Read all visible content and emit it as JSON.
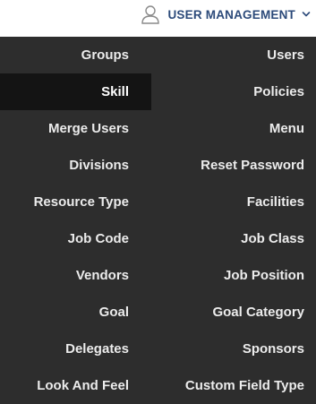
{
  "header": {
    "title": "USER MANAGEMENT",
    "user_icon": "user-icon",
    "chevron_icon": "chevron-down-icon",
    "accent_color": "#2c4a7a"
  },
  "menu": {
    "background_color": "#2d2d2d",
    "active_background_color": "#141414",
    "active_item": "Skill",
    "rows": [
      {
        "left": "Groups",
        "right": "Users"
      },
      {
        "left": "Skill",
        "right": "Policies"
      },
      {
        "left": "Merge Users",
        "right": "Menu"
      },
      {
        "left": "Divisions",
        "right": "Reset Password"
      },
      {
        "left": "Resource Type",
        "right": "Facilities"
      },
      {
        "left": "Job Code",
        "right": "Job Class"
      },
      {
        "left": "Vendors",
        "right": "Job Position"
      },
      {
        "left": "Goal",
        "right": "Goal Category"
      },
      {
        "left": "Delegates",
        "right": "Sponsors"
      },
      {
        "left": "Look And Feel",
        "right": "Custom Field Type"
      }
    ]
  }
}
